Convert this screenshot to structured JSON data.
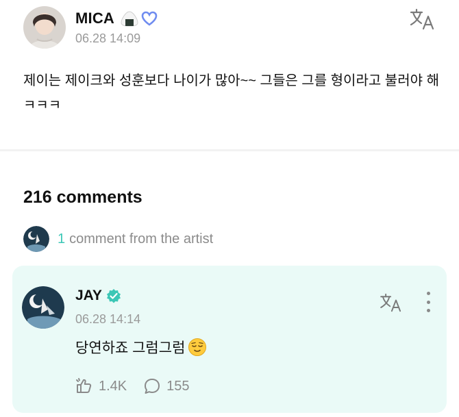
{
  "post": {
    "author": "MICA",
    "timestamp": "06.28 14:09",
    "body": "제이는 제이크와 성훈보다 나이가 많아~~ 그들은 그를 형이라고 불러야 해 ㅋㅋㅋ",
    "badges": [
      "rice-ball-emoji",
      "infinity-heart-icon"
    ]
  },
  "comments_section": {
    "count_label": "216 comments",
    "artist_comments": {
      "count": "1",
      "label": "comment from the artist"
    }
  },
  "artist_comment": {
    "author": "JAY",
    "verified": true,
    "timestamp": "06.28 14:14",
    "text": "당연하죠 그럼그럼",
    "emoji": "relieved-face",
    "likes": "1.4K",
    "replies": "155"
  },
  "colors": {
    "accent": "#3cc7b6",
    "card_bg": "#eafaf7",
    "muted": "#9a9a9a"
  }
}
